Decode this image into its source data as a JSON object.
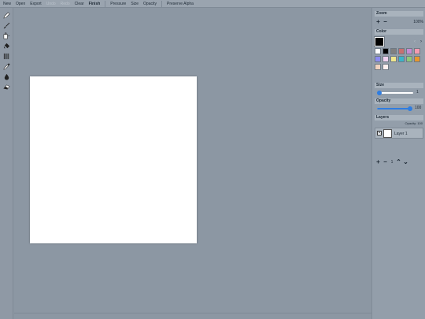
{
  "menu": {
    "new": "New",
    "open": "Open",
    "export": "Export",
    "undo": "Undo",
    "redo": "Redo",
    "clear": "Clear",
    "finish": "Finish",
    "pressure": "Pressure",
    "size": "Size",
    "opacity": "Opacity",
    "preserve_alpha": "Preserve Alpha"
  },
  "tools": [
    "pencil-icon",
    "brush-icon",
    "fill-bucket-icon",
    "paint-bucket-icon",
    "pattern-icon",
    "eyedropper-icon",
    "blur-drop-icon",
    "eraser-icon"
  ],
  "zoom": {
    "title": "Zoom",
    "plus": "+",
    "minus": "−",
    "value": "100%"
  },
  "color": {
    "title": "Color",
    "primary": "#000000",
    "swatches": [
      "#ffffff",
      "#000000",
      "#808080",
      "#c87070",
      "#c68cd2",
      "#f39ab0",
      "#8c8cf0",
      "#f0d2f0",
      "#f0e68c",
      "#3cb4c8",
      "#90c878",
      "#e6962e",
      "#f0d2c0",
      "#fff0f0"
    ]
  },
  "size": {
    "title": "Size",
    "value": "1",
    "level": 0.05
  },
  "opacity": {
    "title": "Opacity",
    "value": "100",
    "level": 1.0
  },
  "layers": {
    "title": "Layers",
    "opacity_label": "Opacity: 100",
    "items": [
      {
        "name": "Layer 1",
        "visible_mark": "✕"
      }
    ],
    "count": "1",
    "add": "+",
    "remove": "−",
    "up": "⌃",
    "down": "⌄"
  }
}
